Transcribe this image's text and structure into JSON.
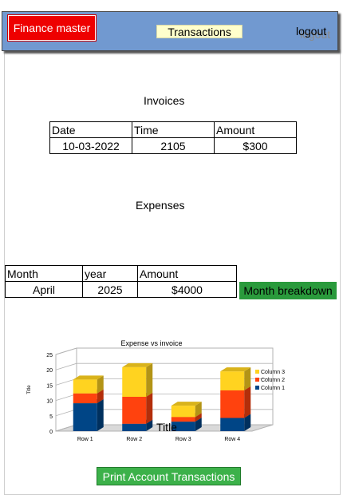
{
  "header": {
    "brand": "Finance master",
    "nav_transactions": "Transactions",
    "logout": "logout"
  },
  "invoices": {
    "title": "Invoices",
    "columns": [
      "Date",
      "Time",
      "Amount"
    ],
    "rows": [
      [
        "10-03-2022",
        "2105",
        "$300"
      ]
    ]
  },
  "expenses": {
    "title": "Expenses",
    "columns": [
      "Month",
      "year",
      "Amount"
    ],
    "rows": [
      [
        "April",
        "2025",
        "$4000"
      ]
    ],
    "breakdown_button": "Month breakdown"
  },
  "chart_data": {
    "type": "bar",
    "stacked": true,
    "three_d": true,
    "title": "Expense vs invoice",
    "subtitle": "Title",
    "ylabel": "Title",
    "xlabel": "",
    "categories": [
      "Row 1",
      "Row 2",
      "Row 3",
      "Row 4"
    ],
    "ylim": [
      0,
      25
    ],
    "yticks": [
      0,
      5,
      10,
      15,
      20,
      25
    ],
    "grid": true,
    "legend_position": "right",
    "series": [
      {
        "name": "Column 1",
        "values": [
          9.1,
          2.4,
          3.1,
          4.3
        ],
        "color": "#004586"
      },
      {
        "name": "Column 2",
        "values": [
          3.2,
          8.8,
          1.5,
          9.0
        ],
        "color": "#ff420e"
      },
      {
        "name": "Column 3",
        "values": [
          4.54,
          9.65,
          3.7,
          6.2
        ],
        "color": "#ffd320"
      }
    ]
  },
  "footer": {
    "print_button": "Print Account Transactions"
  }
}
